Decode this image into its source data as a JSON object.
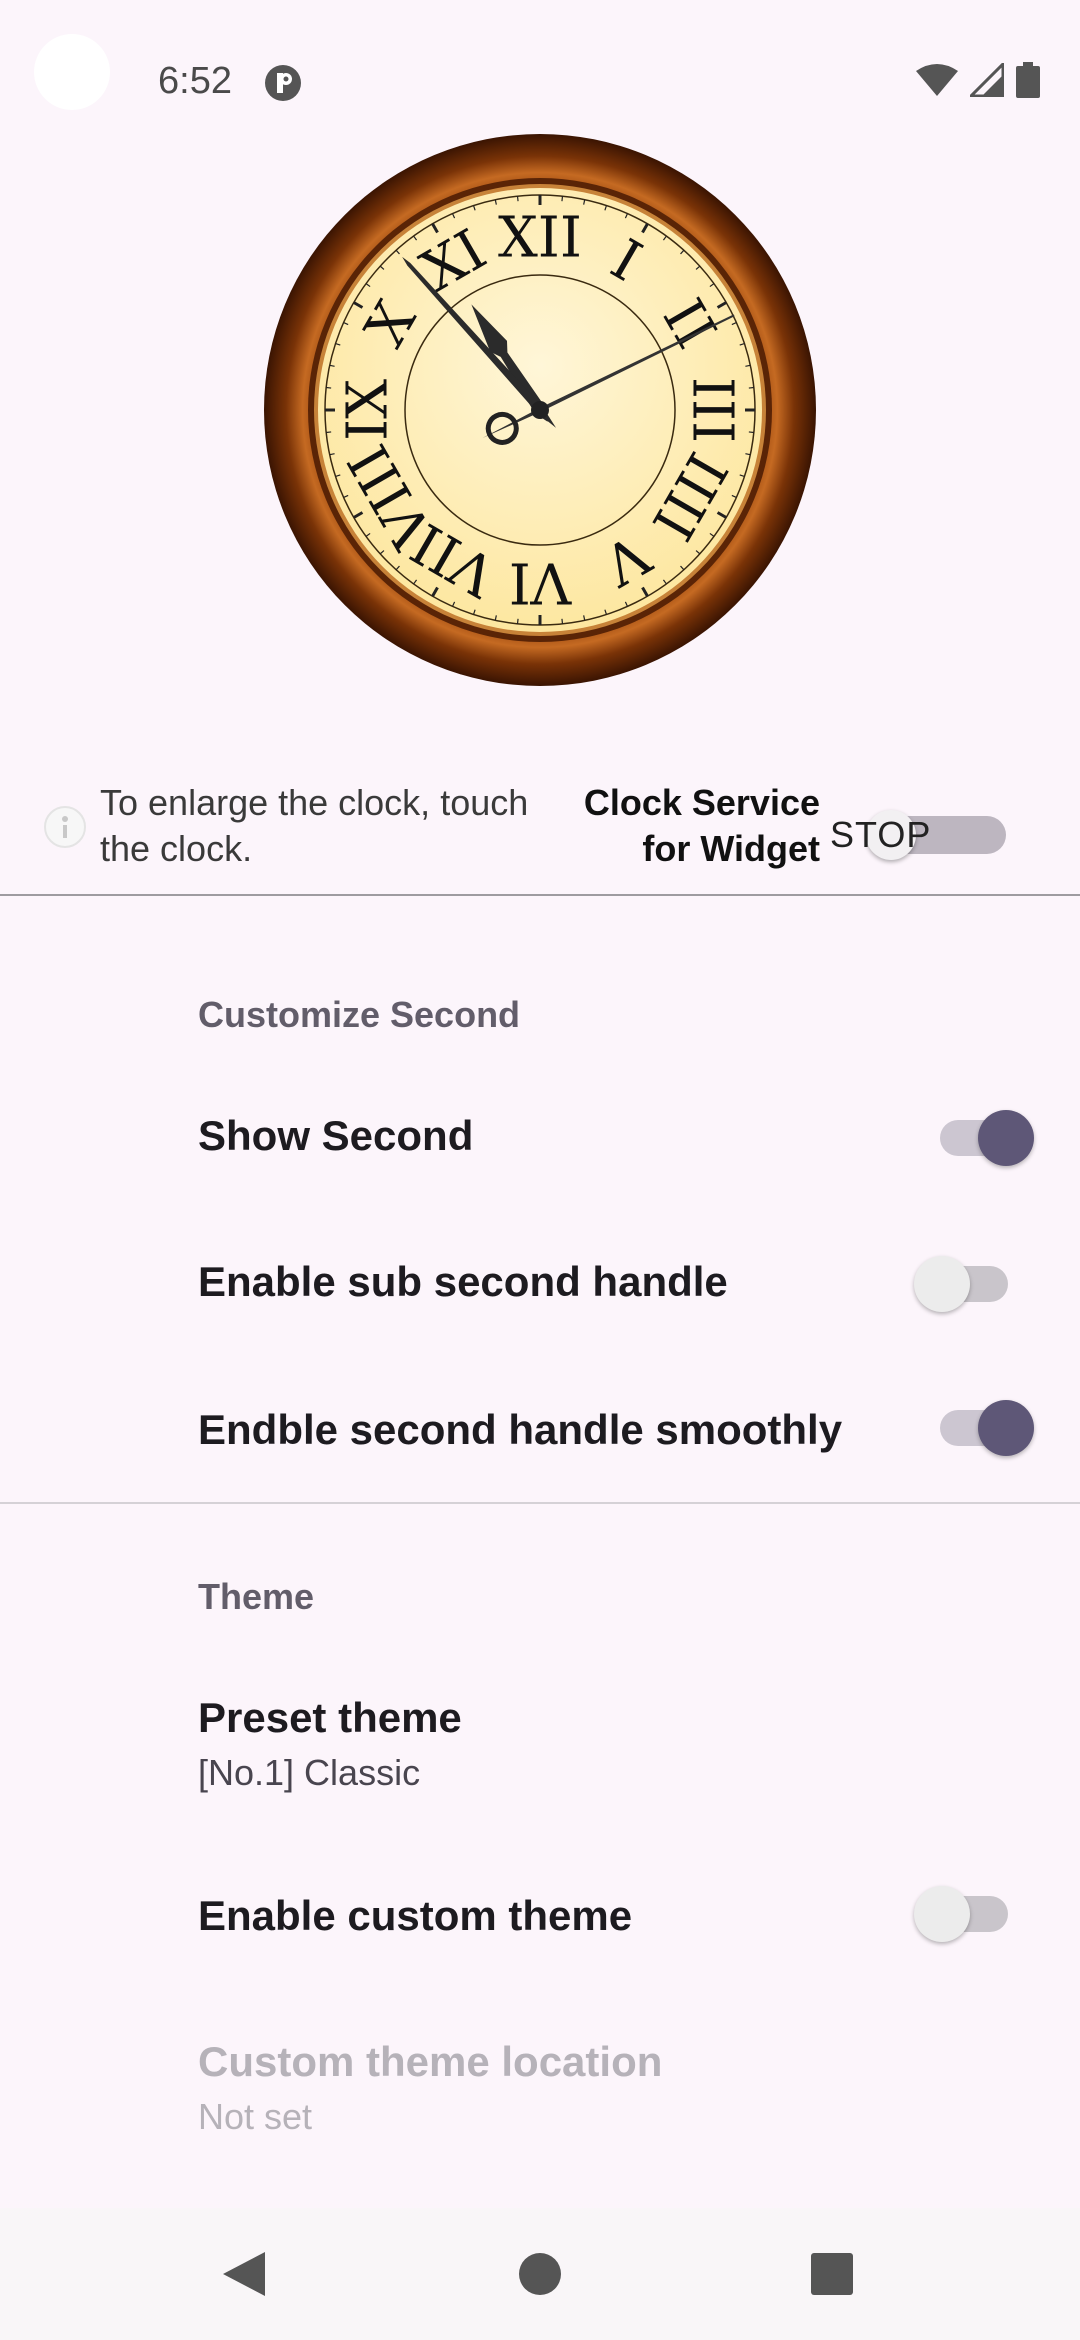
{
  "status_bar": {
    "time": "6:52",
    "app_icon": "app-notification-icon",
    "icons": [
      "wifi-icon",
      "signal-icon",
      "battery-icon"
    ]
  },
  "clock": {
    "numerals": [
      "XII",
      "I",
      "II",
      "III",
      "IIII",
      "V",
      "VI",
      "VII",
      "VIII",
      "IX",
      "X",
      "XI"
    ],
    "time_shown": "10:53"
  },
  "info": {
    "hint_line1": "To enlarge the clock, touch",
    "hint_line2": "the clock.",
    "service_line1": "Clock Service",
    "service_line2": "for Widget",
    "switch_label": "STOP"
  },
  "customize_second": {
    "header": "Customize Second",
    "items": [
      {
        "title": "Show Second",
        "checked": true
      },
      {
        "title": "Enable sub second handle",
        "checked": false
      },
      {
        "title": "Endble second handle smoothly",
        "checked": true
      }
    ]
  },
  "theme": {
    "header": "Theme",
    "preset_title": "Preset theme",
    "preset_value": "[No.1] Classic",
    "custom_title": "Enable custom theme",
    "custom_checked": false,
    "location_title": "Custom theme location",
    "location_value": "Not set"
  },
  "nav_bar": {
    "buttons": [
      "back-icon",
      "home-icon",
      "recents-icon"
    ]
  },
  "colors": {
    "background": "#fcf5fb",
    "accent": "#5e5777",
    "wood": "#6b2f08",
    "dial": "#fff1c2"
  }
}
